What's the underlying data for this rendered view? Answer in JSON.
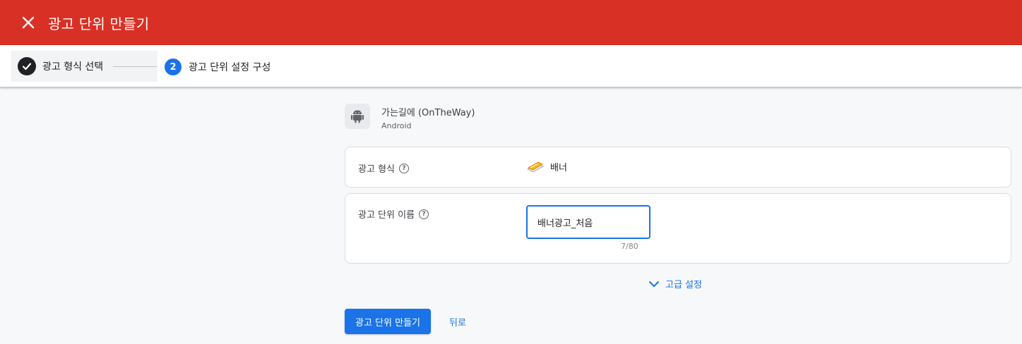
{
  "header": {
    "title": "광고 단위 만들기",
    "close_icon": "close-icon",
    "background_color": "#d93025"
  },
  "stepper": {
    "steps": [
      {
        "label": "광고 형식 선택",
        "state": "completed",
        "icon": "check-icon"
      },
      {
        "number": "2",
        "label": "광고 단위 설정 구성",
        "state": "active"
      }
    ]
  },
  "app": {
    "name": "가는길에 (OnTheWay)",
    "platform": "Android",
    "icon": "android-icon"
  },
  "form": {
    "ad_format": {
      "label": "광고 형식",
      "value": "배너",
      "help_icon": "help-icon",
      "value_icon": "banner-icon"
    },
    "ad_unit_name": {
      "label": "광고 단위 이름",
      "value": "배너광고_처음",
      "help_icon": "help-icon",
      "char_count": "7/80"
    }
  },
  "advanced_settings": {
    "label": "고급 설정",
    "icon": "chevron-down-icon"
  },
  "actions": {
    "create_label": "광고 단위 만들기",
    "back_label": "뒤로"
  },
  "colors": {
    "primary": "#1a73e8",
    "header": "#d93025"
  }
}
